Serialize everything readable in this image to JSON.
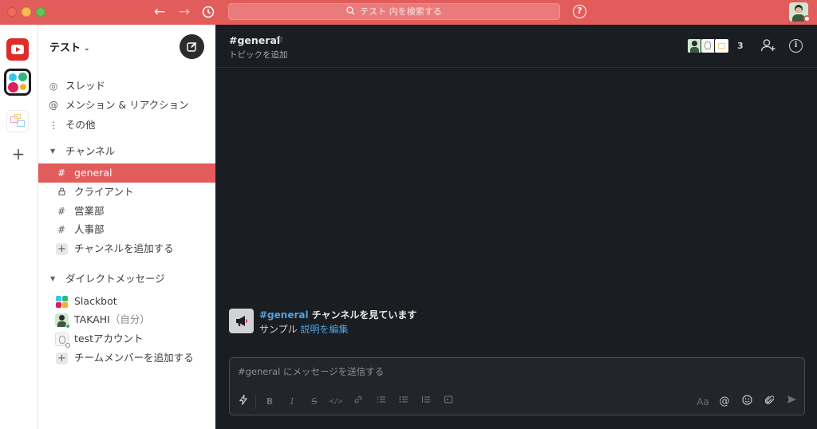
{
  "titlebar": {
    "search_placeholder": "テスト 内を検索する",
    "help_label": "?"
  },
  "rail": {
    "workspaces": [
      "youtube",
      "slack",
      "other"
    ],
    "add_label": "+"
  },
  "sidebar": {
    "workspace_name": "テスト",
    "nav": [
      {
        "icon": "threads-icon",
        "glyph": "◎",
        "label": "スレッド"
      },
      {
        "icon": "mention-icon",
        "glyph": "@",
        "label": "メンション & リアクション"
      },
      {
        "icon": "more-icon",
        "glyph": "⋮",
        "label": "その他"
      }
    ],
    "channels_header": "チャンネル",
    "channels": [
      {
        "glyph": "#",
        "label": "general",
        "active": true
      },
      {
        "glyph": "🔒",
        "label": "クライアント"
      },
      {
        "glyph": "#",
        "label": "営業部"
      },
      {
        "glyph": "#",
        "label": "人事部"
      }
    ],
    "add_channel_label": "チャンネルを追加する",
    "dm_header": "ダイレクトメッセージ",
    "dms": [
      {
        "label": "Slackbot",
        "self": ""
      },
      {
        "label": "TAKAHI",
        "self": "（自分）"
      },
      {
        "label": "testアカウント",
        "self": ""
      }
    ],
    "add_member_label": "チームメンバーを追加する"
  },
  "channel": {
    "title": "#general",
    "topic_placeholder": "トピックを追加",
    "member_count": "3",
    "info_label": "i"
  },
  "intro": {
    "channel_link": "#general",
    "title_suffix": " チャンネルを見ています",
    "sample_text": "サンプル ",
    "edit_link": "説明を編集"
  },
  "composer": {
    "placeholder": "#general にメッセージを送信する",
    "format_labels": {
      "bold": "B",
      "italic": "I",
      "code": "</>",
      "aa": "Aa",
      "at": "@"
    }
  },
  "colors": {
    "accent": "#e25c5c",
    "main_bg": "#1a1d21",
    "link": "#4fa3e3"
  }
}
